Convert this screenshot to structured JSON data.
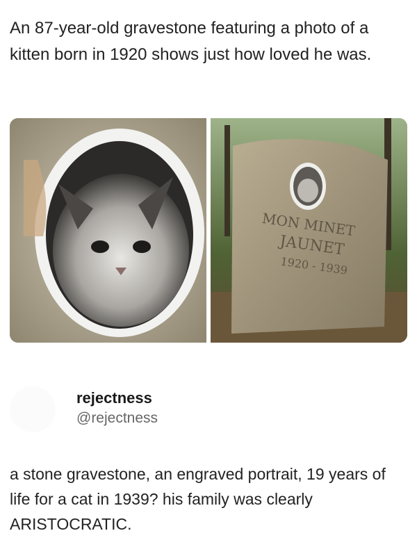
{
  "headline": "An 87-year-old gravestone featuring a photo of a kitten born in 1920 shows just how loved he was.",
  "images": {
    "left_icon": "photo-image",
    "right_icon": "photo-image",
    "engraving_line1": "MON MINET",
    "engraving_line2": "JAUNET",
    "engraving_line3": "1920 - 1939"
  },
  "author": {
    "display_name": "rejectness",
    "handle": "@rejectness"
  },
  "post": {
    "text": "a stone gravestone, an engraved portrait, 19 years of life for a cat in 1939? his family was clearly ARISTOCRATIC."
  }
}
